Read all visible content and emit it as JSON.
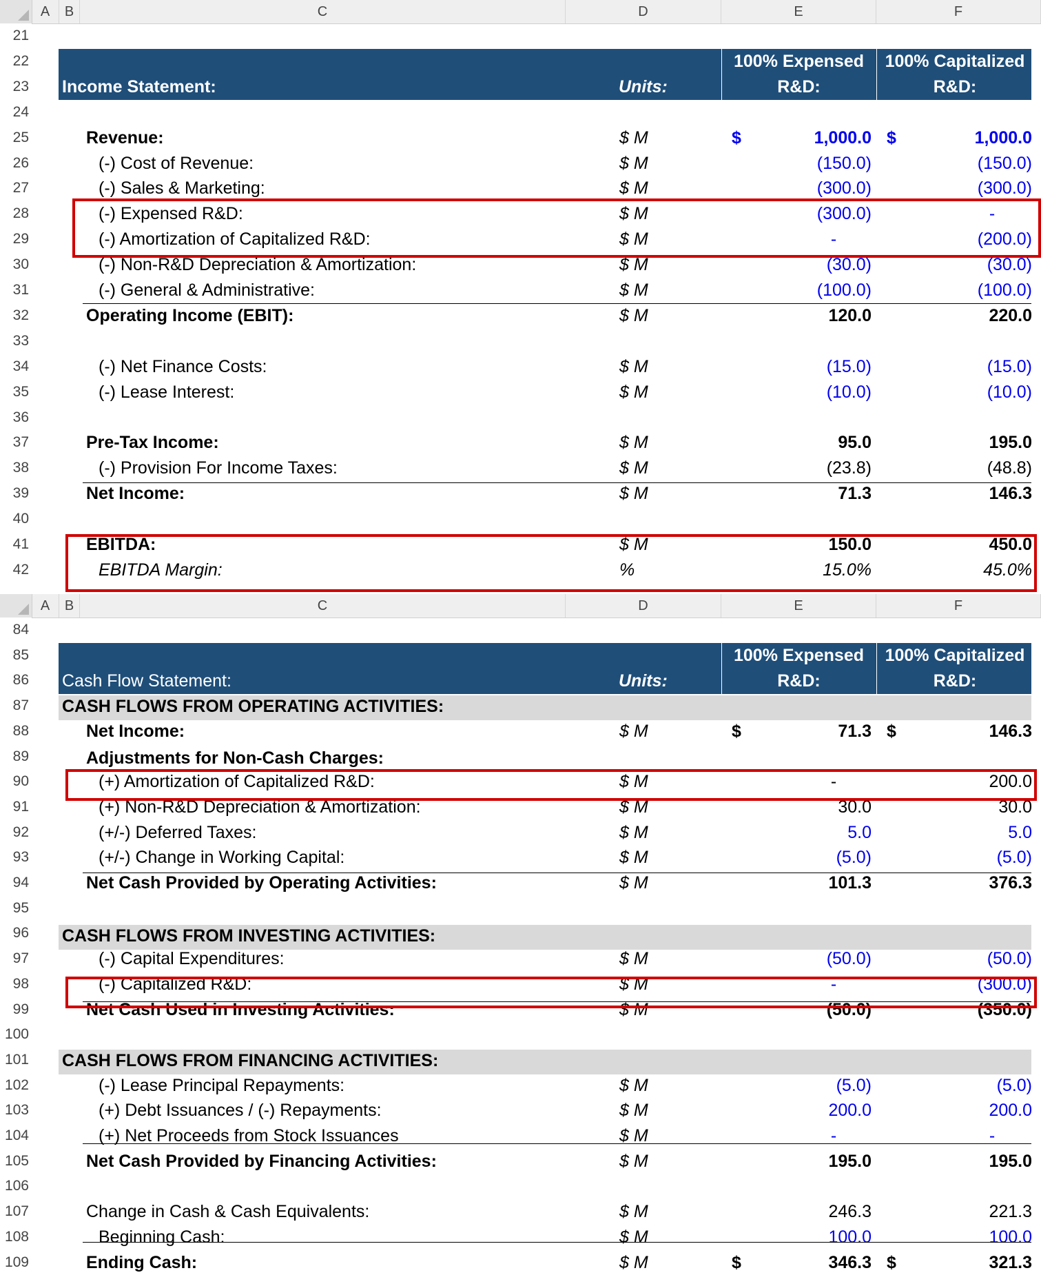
{
  "columns": [
    "A",
    "B",
    "C",
    "D",
    "E",
    "F"
  ],
  "income_statement": {
    "title": "Income Statement:",
    "units_header": "Units:",
    "col_e_header": [
      "100% Expensed",
      "R&D:"
    ],
    "col_f_header": [
      "100% Capitalized",
      "R&D:"
    ],
    "row_numbers": [
      "21",
      "22",
      "23",
      "24",
      "25",
      "26",
      "27",
      "28",
      "29",
      "30",
      "31",
      "32",
      "33",
      "34",
      "35",
      "36",
      "37",
      "38",
      "39",
      "40",
      "41",
      "42"
    ],
    "rows": [
      {
        "row": "25",
        "label": "Revenue:",
        "units": "$ M",
        "e": "1,000.0",
        "f": "1,000.0",
        "e_prefix": "$",
        "f_prefix": "$"
      },
      {
        "row": "26",
        "label": "(-) Cost of Revenue:",
        "units": "$ M",
        "e": "(150.0)",
        "f": "(150.0)"
      },
      {
        "row": "27",
        "label": "(-) Sales & Marketing:",
        "units": "$ M",
        "e": "(300.0)",
        "f": "(300.0)"
      },
      {
        "row": "28",
        "label": "(-) Expensed R&D:",
        "units": "$ M",
        "e": "(300.0)",
        "f": "-"
      },
      {
        "row": "29",
        "label": "(-) Amortization of Capitalized R&D:",
        "units": "$ M",
        "e": "-",
        "f": "(200.0)"
      },
      {
        "row": "30",
        "label": "(-) Non-R&D Depreciation & Amortization:",
        "units": "$ M",
        "e": "(30.0)",
        "f": "(30.0)"
      },
      {
        "row": "31",
        "label": "(-) General & Administrative:",
        "units": "$ M",
        "e": "(100.0)",
        "f": "(100.0)"
      },
      {
        "row": "32",
        "label": "Operating Income (EBIT):",
        "units": "$ M",
        "e": "120.0",
        "f": "220.0"
      },
      {
        "row": "34",
        "label": "(-) Net Finance Costs:",
        "units": "$ M",
        "e": "(15.0)",
        "f": "(15.0)"
      },
      {
        "row": "35",
        "label": "(-) Lease Interest:",
        "units": "$ M",
        "e": "(10.0)",
        "f": "(10.0)"
      },
      {
        "row": "37",
        "label": "Pre-Tax Income:",
        "units": "$ M",
        "e": "95.0",
        "f": "195.0"
      },
      {
        "row": "38",
        "label": "(-) Provision For Income Taxes:",
        "units": "$ M",
        "e": "(23.8)",
        "f": "(48.8)"
      },
      {
        "row": "39",
        "label": "Net Income:",
        "units": "$ M",
        "e": "71.3",
        "f": "146.3"
      },
      {
        "row": "41",
        "label": "EBITDA:",
        "units": "$ M",
        "e": "150.0",
        "f": "450.0"
      },
      {
        "row": "42",
        "label": "EBITDA Margin:",
        "units": "%",
        "e": "15.0%",
        "f": "45.0%"
      }
    ]
  },
  "cash_flow_statement": {
    "title": "Cash Flow Statement:",
    "units_header": "Units:",
    "col_e_header": [
      "100% Expensed",
      "R&D:"
    ],
    "col_f_header": [
      "100% Capitalized",
      "R&D:"
    ],
    "row_numbers": [
      "84",
      "85",
      "86",
      "87",
      "88",
      "89",
      "90",
      "91",
      "92",
      "93",
      "94",
      "95",
      "96",
      "97",
      "98",
      "99",
      "100",
      "101",
      "102",
      "103",
      "104",
      "105",
      "106",
      "107",
      "108",
      "109"
    ],
    "section_operating": "CASH FLOWS FROM OPERATING ACTIVITIES:",
    "section_investing": "CASH FLOWS FROM INVESTING ACTIVITIES:",
    "section_financing": "CASH FLOWS FROM FINANCING ACTIVITIES:",
    "adjustments_label": "Adjustments for Non-Cash Charges:",
    "rows": [
      {
        "row": "88",
        "label": "Net Income:",
        "units": "$ M",
        "e": "71.3",
        "f": "146.3",
        "e_prefix": "$",
        "f_prefix": "$"
      },
      {
        "row": "90",
        "label": "(+) Amortization of Capitalized R&D:",
        "units": "$ M",
        "e": "-",
        "f": "200.0"
      },
      {
        "row": "91",
        "label": "(+) Non-R&D Depreciation & Amortization:",
        "units": "$ M",
        "e": "30.0",
        "f": "30.0"
      },
      {
        "row": "92",
        "label": "(+/-) Deferred Taxes:",
        "units": "$ M",
        "e": "5.0",
        "f": "5.0"
      },
      {
        "row": "93",
        "label": "(+/-) Change in Working Capital:",
        "units": "$ M",
        "e": "(5.0)",
        "f": "(5.0)"
      },
      {
        "row": "94",
        "label": "Net Cash Provided by Operating Activities:",
        "units": "$ M",
        "e": "101.3",
        "f": "376.3"
      },
      {
        "row": "97",
        "label": "(-) Capital Expenditures:",
        "units": "$ M",
        "e": "(50.0)",
        "f": "(50.0)"
      },
      {
        "row": "98",
        "label": "(-) Capitalized R&D:",
        "units": "$ M",
        "e": "-",
        "f": "(300.0)"
      },
      {
        "row": "99",
        "label": "Net Cash Used in Investing Activities:",
        "units": "$ M",
        "e": "(50.0)",
        "f": "(350.0)"
      },
      {
        "row": "102",
        "label": "(-) Lease Principal Repayments:",
        "units": "$ M",
        "e": "(5.0)",
        "f": "(5.0)"
      },
      {
        "row": "103",
        "label": "(+) Debt Issuances / (-) Repayments:",
        "units": "$ M",
        "e": "200.0",
        "f": "200.0"
      },
      {
        "row": "104",
        "label": "(+) Net Proceeds from Stock Issuances",
        "units": "$ M",
        "e": "-",
        "f": "-"
      },
      {
        "row": "105",
        "label": "Net Cash Provided by Financing Activities:",
        "units": "$ M",
        "e": "195.0",
        "f": "195.0"
      },
      {
        "row": "107",
        "label": "Change in Cash & Cash Equivalents:",
        "units": "$ M",
        "e": "246.3",
        "f": "221.3"
      },
      {
        "row": "108",
        "label": "Beginning Cash:",
        "units": "$ M",
        "e": "100.0",
        "f": "100.0"
      },
      {
        "row": "109",
        "label": "Ending Cash:",
        "units": "$ M",
        "e": "346.3",
        "f": "321.3",
        "e_prefix": "$",
        "f_prefix": "$"
      }
    ]
  },
  "colors": {
    "header_bg": "#1f4e79",
    "input_blue": "#0000ee",
    "highlight_red": "#d00000",
    "section_gray": "#d9d9d9"
  }
}
